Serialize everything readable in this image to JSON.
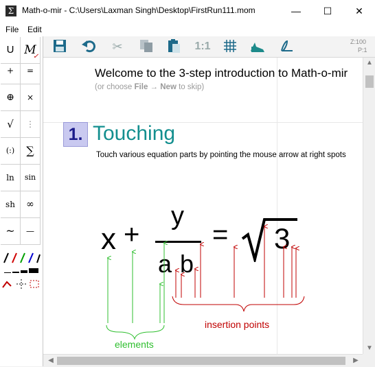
{
  "window": {
    "app_icon": "Σ",
    "title": "Math-o-mir - C:\\Users\\Laxman Singh\\Desktop\\FirstRun111.mom",
    "minimize": "—",
    "maximize": "☐",
    "close": "✕"
  },
  "menu": {
    "file": "File",
    "edit": "Edit"
  },
  "palette": {
    "u": "U",
    "m": "M",
    "plus": "+",
    "equals": "=",
    "oplus": "⊕",
    "times": "×",
    "sqrt": "√",
    "frac": "⋮",
    "paren": "(:)",
    "sum": "∑",
    "ln": "ln",
    "sin": "sin",
    "sh": "sh",
    "infinity": "∞",
    "tilde": "~",
    "dash": "—"
  },
  "toolbar": {
    "zoom": "Z:100",
    "page": "P:1",
    "ratio": "1:1"
  },
  "document": {
    "welcome": "Welcome to the 3-step introduction to Math-o-mir",
    "hint_prefix": "(or choose ",
    "hint_file": "File",
    "hint_arrow": "→",
    "hint_new": "New",
    "hint_suffix": " to skip)",
    "step_number": "1.",
    "step_title": "Touching",
    "step_desc": "Touch various equation parts by pointing the mouse arrow at right spots",
    "eq_x": "x",
    "eq_plus": "+",
    "eq_y": "y",
    "eq_a": "a",
    "eq_b": "b",
    "eq_equals": "=",
    "eq_3": "3",
    "label_insertion": "insertion points",
    "label_elements": "elements"
  },
  "colors": {
    "accent_teal": "#138f8f",
    "insertion_red": "#c00000",
    "elements_green": "#2fbf2f",
    "step_box": "#c9c9f0"
  }
}
